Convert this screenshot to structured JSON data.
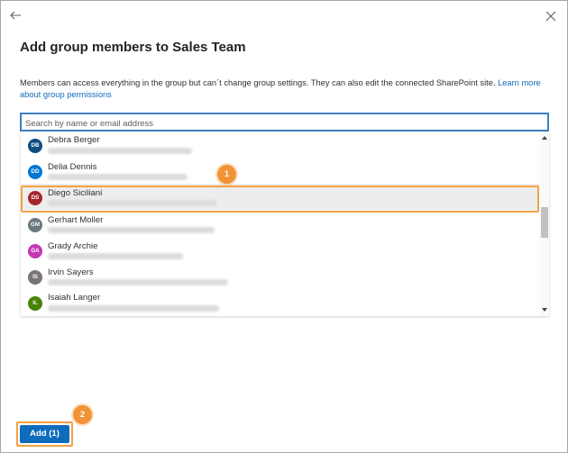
{
  "dialog": {
    "title": "Add group members to Sales Team",
    "description": "Members can access everything in the group but can´t change group settings. They can also edit the connected SharePoint site.",
    "learn_more": "Learn more about group permissions"
  },
  "search": {
    "placeholder": "Search by name or email address",
    "value": ""
  },
  "people": [
    {
      "initials": "DB",
      "name": "Debra Berger",
      "color": "#0f4c81"
    },
    {
      "initials": "DD",
      "name": "Delia Dennis",
      "color": "#0078d4"
    },
    {
      "initials": "DS",
      "name": "Diego Siciliani",
      "color": "#a4262c",
      "selected": true
    },
    {
      "initials": "GM",
      "name": "Gerhart Moller",
      "color": "#69797e"
    },
    {
      "initials": "GA",
      "name": "Grady Archie",
      "color": "#c239b3"
    },
    {
      "initials": "IS",
      "name": "Irvin Sayers",
      "color": "#7a7574"
    },
    {
      "initials": "IL",
      "name": "Isaiah Langer",
      "color": "#498205"
    }
  ],
  "callouts": {
    "one": "1",
    "two": "2"
  },
  "footer": {
    "add_label": "Add (1)"
  },
  "colors": {
    "accent": "#0f6cbd",
    "highlight": "#f5a043",
    "callout": "#f29237"
  },
  "icons": {
    "back": "arrow-left-icon",
    "close": "close-icon"
  }
}
